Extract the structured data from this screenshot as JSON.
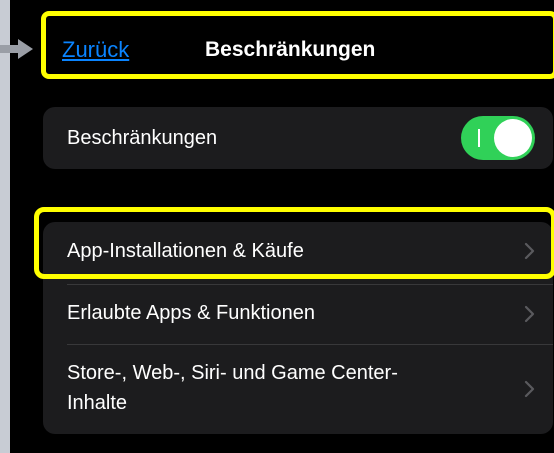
{
  "nav": {
    "back_label": "Zurück",
    "title": "Beschränkungen"
  },
  "restrictions_toggle": {
    "label": "Beschränkungen",
    "state": "on"
  },
  "menu": {
    "items": [
      {
        "label": "App-Installationen & Käufe"
      },
      {
        "label": "Erlaubte Apps & Funktionen"
      },
      {
        "label_line1": "Store-, Web-, Siri- und Game Center-",
        "label_line2": "Inhalte"
      }
    ]
  },
  "colors": {
    "background": "#000000",
    "cell": "#1c1c1e",
    "accent_link": "#0a84ff",
    "toggle_on": "#30d158",
    "highlight": "#ffff00"
  }
}
